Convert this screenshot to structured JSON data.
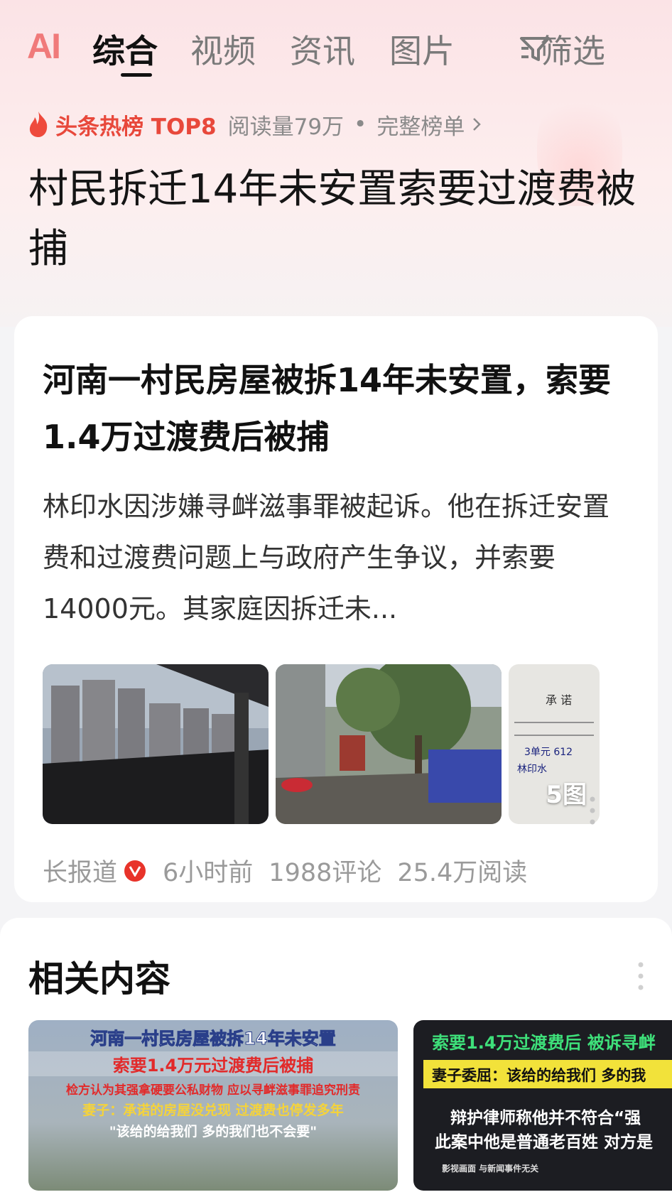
{
  "tabs": {
    "ai": "AI",
    "items": [
      "综合",
      "视频",
      "资讯",
      "图片"
    ],
    "filter": "筛选"
  },
  "hot": {
    "title": "头条热榜 TOP8",
    "reads": "阅读量79万",
    "dot": "•",
    "full_list": "完整榜单"
  },
  "headline": "村民拆迁14年未安置索要过渡费被捕",
  "article": {
    "title": "河南一村民房屋被拆14年未安置，索要1.4万过渡费后被捕",
    "summary": "林印水因涉嫌寻衅滋事罪被起诉。他在拆迁安置费和过渡费问题上与政府产生争议，并索要14000元。其家庭因拆迁未...",
    "image_count": "5图",
    "source": "长报道",
    "time": "6小时前",
    "comments": "1988评论",
    "reads": "25.4万阅读",
    "doc_text": {
      "heading": "承 诺",
      "handwriting": "3单元 612",
      "signature": "林印水"
    }
  },
  "related": {
    "title": "相关内容",
    "items": [
      {
        "line1": "河南一村民房屋被拆14年未安置",
        "line2": "索要1.4万元过渡费后被捕",
        "line3": "检方认为其强拿硬要公私财物 应以寻衅滋事罪追究刑责",
        "line4": "妻子：承诺的房屋没兑现 过渡费也停发多年",
        "line5": "\"该给的给我们 多的我们也不会要\""
      },
      {
        "line1": "索要1.4万过渡费后 被诉寻衅",
        "line2": "妻子委屈：该给的给我们 多的我",
        "line3": "辩护律师称他并不符合“强",
        "line4": "此案中他是普通老百姓 对方是",
        "line5": "影视画面 与新闻事件无关"
      }
    ]
  },
  "colors": {
    "accent_red": "#e8483b",
    "ai_pink": "#f07a7a",
    "verified_red": "#e8332a"
  }
}
